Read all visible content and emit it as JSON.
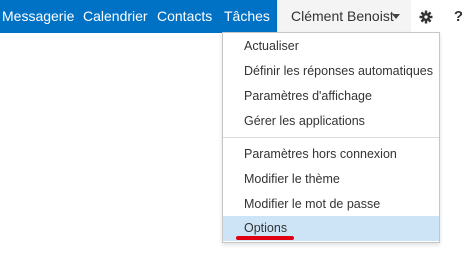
{
  "nav": {
    "items": [
      "Messagerie",
      "Calendrier",
      "Contacts",
      "Tâches"
    ]
  },
  "user": {
    "name": "Clément Benoist"
  },
  "icons": {
    "settings": "gear-icon",
    "help": "?"
  },
  "menu": {
    "group1": [
      "Actualiser",
      "Définir les réponses automatiques",
      "Paramètres d'affichage",
      "Gérer les applications"
    ],
    "group2": [
      "Paramètres hors connexion",
      "Modifier le thème",
      "Modifier le mot de passe",
      "Options"
    ],
    "highlighted": "Options"
  },
  "colors": {
    "topbar": "#0072c6",
    "highlight": "#cde4f7",
    "annotation": "#e0000f"
  }
}
